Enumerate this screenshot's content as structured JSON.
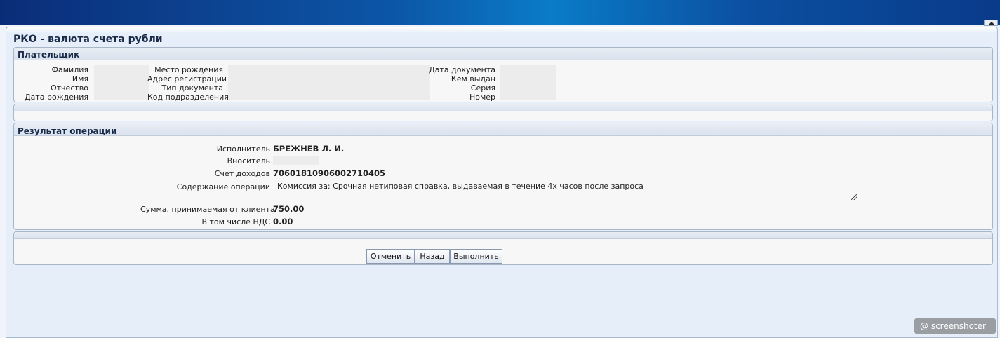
{
  "page": {
    "title": "РКО - валюта счета рубли"
  },
  "payer": {
    "title": "Плательщик",
    "col1": [
      "Фамилия",
      "Имя",
      "Отчество",
      "Дата рождения"
    ],
    "col2": [
      "Место рождения",
      "Адрес регистрации",
      "Тип документа",
      "Код подразделения"
    ],
    "col3": [
      "Дата документа",
      "Кем выдан",
      "Серия",
      "Номер"
    ]
  },
  "result": {
    "title": "Результат операции",
    "executor_label": "Исполнитель",
    "executor_value": "БРЕЖНЕВ Л. И.",
    "depositor_label": "Вноситель",
    "income_account_label": "Счет доходов",
    "income_account_value": "70601810906002710405",
    "operation_label": "Содержание операции",
    "operation_value": "Комиссия за: Срочная нетиповая справка, выдаваемая в течение 4х часов после запроса",
    "amount_label": "Сумма, принимаемая от клиента",
    "amount_value": "750.00",
    "vat_label": "В том числе НДС",
    "vat_value": "0.00"
  },
  "actions": {
    "cancel_label": "Отменить",
    "back_label": "Назад",
    "execute_label": "Выполнить"
  },
  "watermark": {
    "text": "@ screenshoter"
  }
}
